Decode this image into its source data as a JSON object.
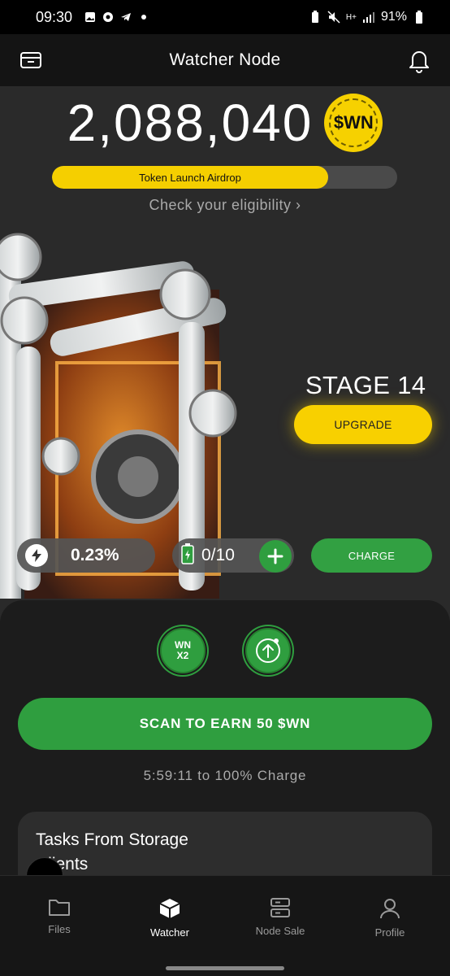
{
  "status_bar": {
    "time": "09:30",
    "battery": "91%",
    "network": "H+"
  },
  "header": {
    "title": "Watcher Node"
  },
  "balance": {
    "amount": "2,088,040",
    "coin_label": "$WN"
  },
  "airdrop": {
    "label": "Token Launch Airdrop",
    "progress_percent": 80,
    "link": "Check your eligibility ›"
  },
  "stage": {
    "label": "STAGE 14",
    "upgrade_label": "UPGRADE"
  },
  "stats": {
    "charge_percent": "0.23%",
    "battery_count": "0/10",
    "charge_label": "CHARGE"
  },
  "boosts": {
    "x2_top": "WN",
    "x2_bottom": "X2"
  },
  "scan": {
    "label": "SCAN TO EARN 50 $WN",
    "timer": "5:59:11 to 100% Charge"
  },
  "tasks": {
    "title": "Tasks From Storage Clients"
  },
  "nav": [
    {
      "label": "Files",
      "icon": "folder-icon",
      "active": false
    },
    {
      "label": "Watcher",
      "icon": "cube-icon",
      "active": true
    },
    {
      "label": "Node Sale",
      "icon": "server-icon",
      "active": false
    },
    {
      "label": "Profile",
      "icon": "user-icon",
      "active": false
    }
  ],
  "colors": {
    "accent_yellow": "#F5CF00",
    "accent_green": "#2F9E3F",
    "background": "#2A2A2A"
  }
}
